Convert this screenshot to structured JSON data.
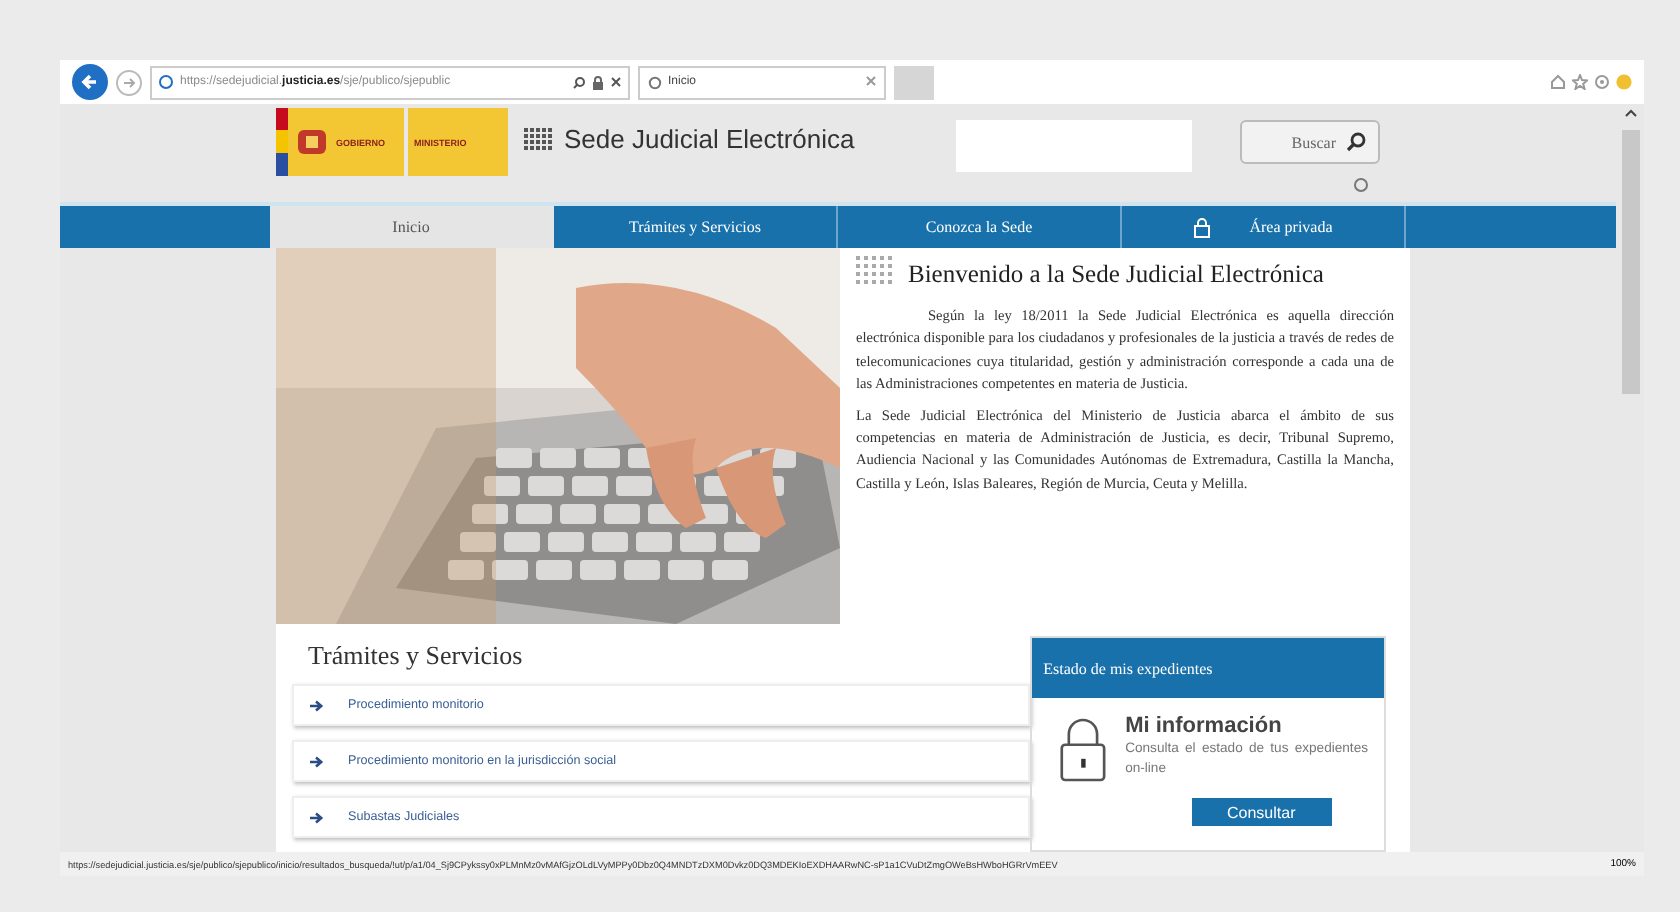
{
  "browser": {
    "address": "https://sedejudicial.**justicia.es**/sje/publico/sjepublic",
    "tab_title": "Inicio",
    "status_url": "https://sedejudicial.justicia.es/sje/publico/sjepublico/inicio/resultados_busqueda/!ut/p/a1/04_Sj9CPykssy0xPLMnMz0vMAfGjzOLdLVyMPPy0Dbz0Q4MNDTzDXM0Dvkz0DQ3MDEKIoEXDHAARwNC-sP1a1CVuDtZmgOWeBsHWboHGRrVmEEV",
    "zoom": "100%"
  },
  "header": {
    "logo_lines": [
      "GOBIERNO",
      "MINISTERIO"
    ],
    "site_title": "Sede Judicial Electrónica",
    "search_button": "Buscar"
  },
  "nav": [
    {
      "label": "Inicio",
      "selected": true,
      "locked": false
    },
    {
      "label": "Trámites y Servicios",
      "selected": false,
      "locked": false
    },
    {
      "label": "Conozca la Sede",
      "selected": false,
      "locked": false
    },
    {
      "label": "Área privada",
      "selected": false,
      "locked": true
    }
  ],
  "welcome": {
    "title": "Bienvenido a la Sede Judicial Electrónica",
    "paragraphs": [
      "Según la ley 18/2011 la Sede Judicial Electrónica es aquella dirección electrónica disponible para los ciudadanos y profesionales de la justicia a través de redes de telecomunicaciones cuya titularidad, gestión y administración corresponde a cada una de las Administraciones competentes en materia de Justicia.",
      "La Sede Judicial Electrónica del Ministerio de Justicia abarca el ámbito de sus competencias en materia de Administración de Justicia, es decir, Tribunal Supremo, Audiencia Nacional y las Comunidades Autónomas de Extremadura, Castilla la Mancha, Castilla y León, Islas Baleares, Región de Murcia, Ceuta y Melilla."
    ]
  },
  "services": {
    "title": "Trámites y Servicios",
    "links": [
      "Procedimiento monitorio",
      "Procedimiento monitorio en la jurisdicción social",
      "Subastas Judiciales"
    ]
  },
  "status_box": {
    "title": "Estado de mis expedientes",
    "heading": "Mi información",
    "text": "Consulta el estado de tus expedientes on-line",
    "button": "Consultar"
  }
}
